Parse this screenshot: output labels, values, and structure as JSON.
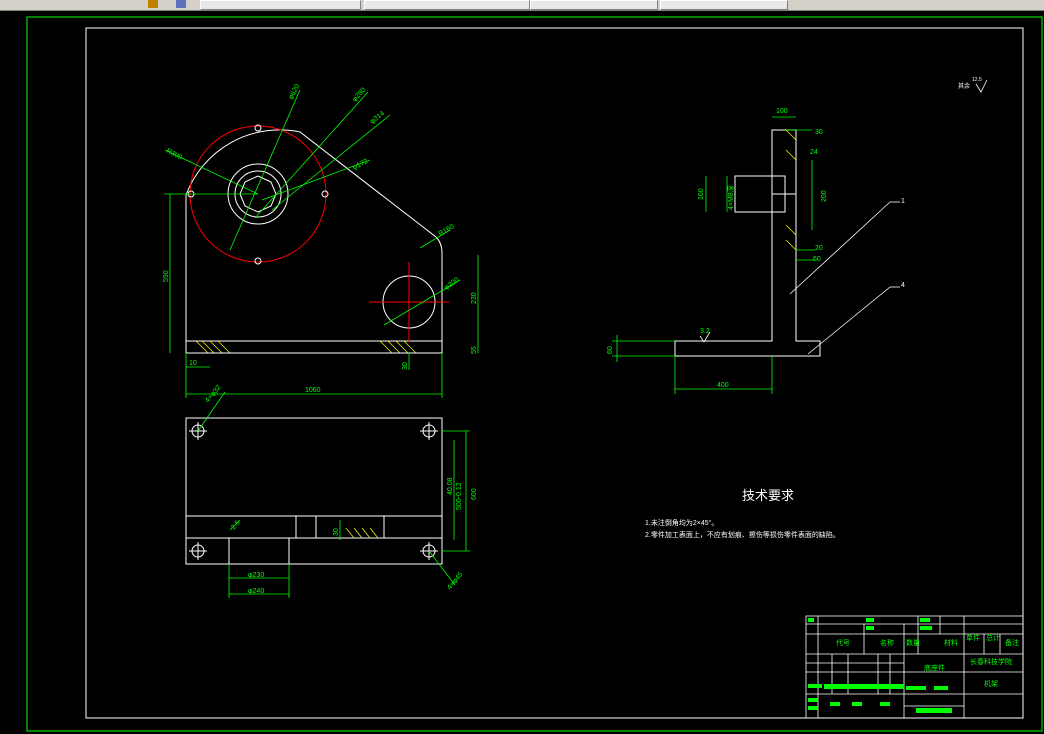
{
  "taskbar": {
    "buttons": [
      "",
      "",
      "",
      "",
      "",
      ""
    ]
  },
  "colors": {
    "background": "#000000",
    "frame": "#00ff00",
    "outline": "#ffffff",
    "dimension": "#00ff00",
    "center": "#ff0000",
    "hatch": "#ffff00"
  },
  "front_view": {
    "dims": {
      "d_outer": "φ620",
      "d_bolt": "φ280",
      "d_bore": "φ214",
      "d_inner": "φ172",
      "r_outer": "R300",
      "r_small": "R160",
      "d_small": "φ200",
      "h_center": "590",
      "h_small": "230",
      "base_h": "55",
      "base_off": "10",
      "base_small": "30",
      "width": "1060"
    }
  },
  "plan_view": {
    "dims": {
      "hole": "4×φ32",
      "h_top": "40.08",
      "h_mid": "500-0.12",
      "h_total": "600",
      "slot": "30",
      "slot_w": "2.5",
      "w1": "φ230",
      "w2": "φ240",
      "hole2": "4×φ45"
    }
  },
  "side_view": {
    "dims": {
      "top": "100",
      "d1": "30",
      "d2": "160",
      "thread": "4×M8深",
      "d3": "200",
      "d4": "20",
      "d5": "60",
      "base_h": "60",
      "base_w": "400",
      "roughness": "3.2",
      "leader1": "1",
      "leader2": "4",
      "note_tag": "24"
    }
  },
  "roughness_note": {
    "label": "其余",
    "value": "12.5"
  },
  "technical_requirements": {
    "title": "技术要求",
    "lines": [
      "1.未注倒角均为2×45°。",
      "2.零件加工表面上，不应有划痕、擦伤等损伤零件表面的缺陷。"
    ]
  },
  "title_block": {
    "headers": [
      "代号",
      "名称",
      "数量",
      "材料",
      "单件",
      "总计",
      "备注"
    ],
    "cells": [
      "底座件",
      "长春科技学院",
      "机架"
    ]
  }
}
